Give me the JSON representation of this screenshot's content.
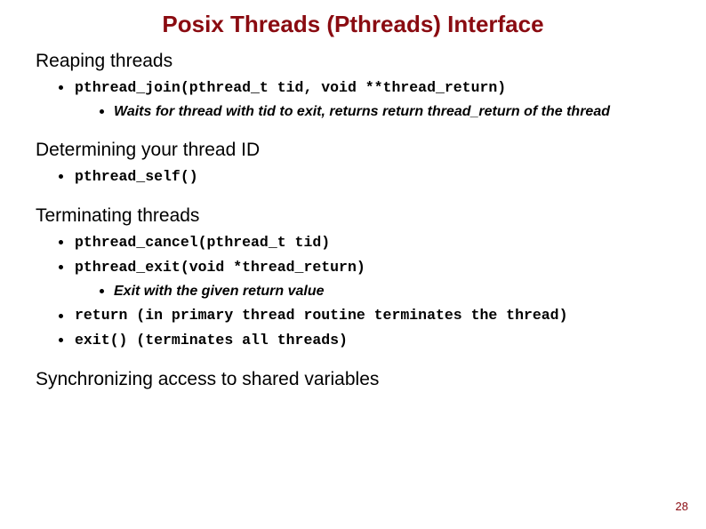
{
  "title": "Posix Threads (Pthreads) Interface",
  "sections": {
    "reaping": {
      "heading": "Reaping threads",
      "join_sig": "pthread_join(pthread_t tid, void **thread_return)",
      "join_note": "Waits for thread with tid  to exit, returns return thread_return of the thread"
    },
    "self": {
      "heading": "Determining your thread ID",
      "self_sig": "pthread_self()"
    },
    "term": {
      "heading": "Terminating threads",
      "cancel_sig": "pthread_cancel(pthread_t tid)",
      "exit_sig": "pthread_exit(void *thread_return)",
      "exit_note": "Exit with the given return value",
      "return_note": "return (in primary thread routine terminates the thread)",
      "exitc_note": "exit() (terminates all threads)"
    },
    "sync": {
      "heading": "Synchronizing access to shared variables"
    }
  },
  "page_number": "28"
}
